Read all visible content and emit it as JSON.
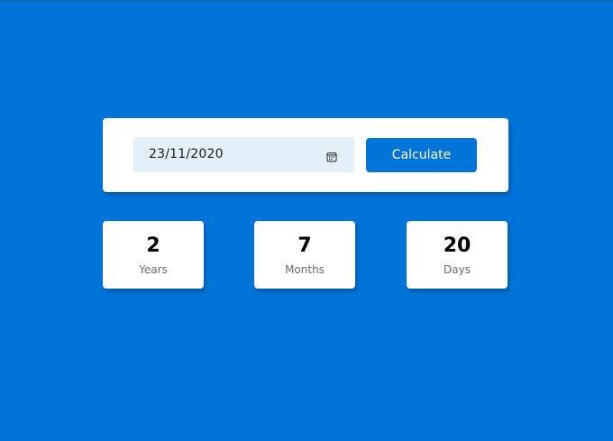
{
  "colors": {
    "background": "#0074d9",
    "card": "#ffffff",
    "input_background": "#e3eff9",
    "button": "#0074d9",
    "value_text": "#000000",
    "label_text": "#6b6b6b"
  },
  "form": {
    "date_value": "23/11/2020",
    "calendar_icon": "calendar-icon",
    "button_label": "Calculate"
  },
  "results": [
    {
      "value": "2",
      "label": "Years"
    },
    {
      "value": "7",
      "label": "Months"
    },
    {
      "value": "20",
      "label": "Days"
    }
  ]
}
